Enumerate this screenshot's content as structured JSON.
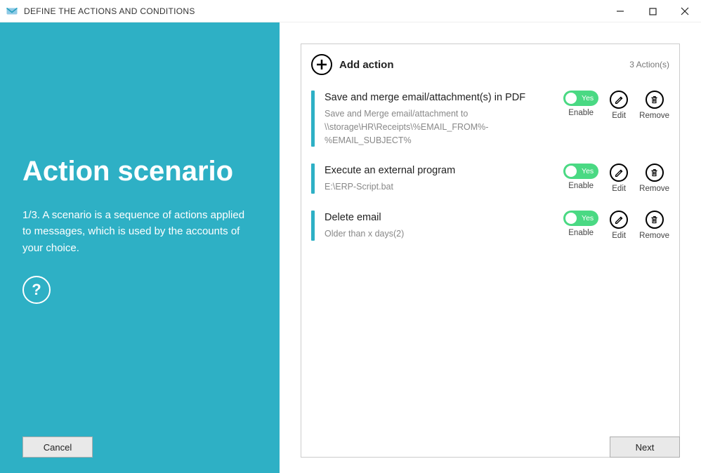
{
  "window": {
    "title": "DEFINE THE ACTIONS AND CONDITIONS"
  },
  "left": {
    "heading": "Action scenario",
    "subtext": "1/3. A scenario is a sequence of actions applied to messages, which is used by the accounts of your choice.",
    "help": "?",
    "cancel": "Cancel"
  },
  "right": {
    "add_label": "Add action",
    "count_label": "3  Action(s)",
    "toggle_yes": "Yes",
    "ctrl_enable": "Enable",
    "ctrl_edit": "Edit",
    "ctrl_remove": "Remove",
    "next": "Next",
    "actions": [
      {
        "title": "Save and merge email/attachment(s) in PDF",
        "sub": "Save and Merge email/attachment to \\\\storage\\HR\\Receipts\\%EMAIL_FROM%-%EMAIL_SUBJECT%"
      },
      {
        "title": "Execute an external program",
        "sub": "E:\\ERP-Script.bat"
      },
      {
        "title": "Delete email",
        "sub": "Older than x days(2)"
      }
    ]
  }
}
